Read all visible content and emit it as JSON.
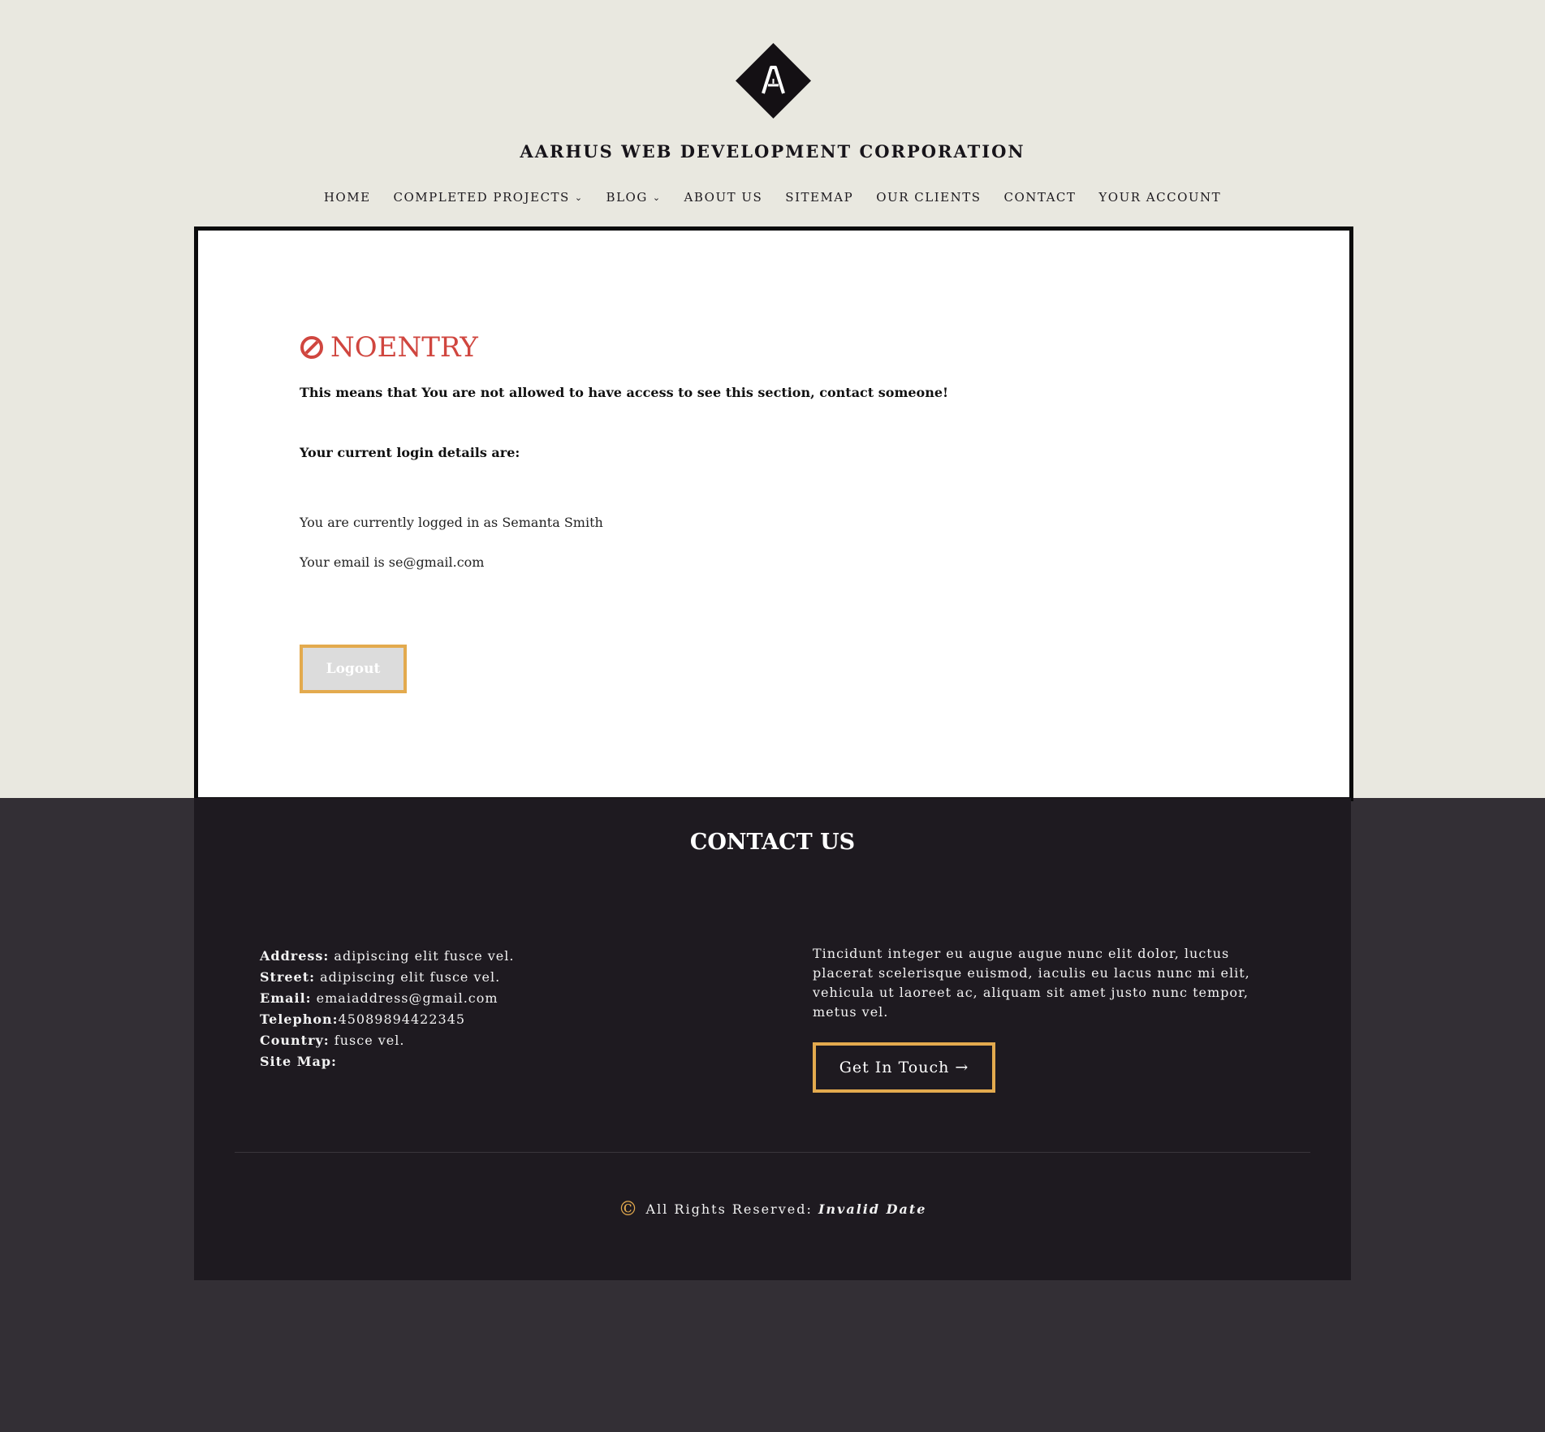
{
  "header": {
    "site_title": "AARHUS WEB DEVELOPMENT CORPORATION",
    "logo_letter": "A"
  },
  "nav": {
    "items": [
      {
        "label": "HOME",
        "has_dropdown": false
      },
      {
        "label": "COMPLETED PROJECTS",
        "has_dropdown": true
      },
      {
        "label": "BLOG",
        "has_dropdown": true
      },
      {
        "label": "ABOUT US",
        "has_dropdown": false
      },
      {
        "label": "SITEMAP",
        "has_dropdown": false
      },
      {
        "label": "OUR CLIENTS",
        "has_dropdown": false
      },
      {
        "label": "CONTACT",
        "has_dropdown": false
      },
      {
        "label": "YOUR ACCOUNT",
        "has_dropdown": false
      }
    ]
  },
  "main": {
    "heading": "NOENTRY",
    "message": "This means that You are not allowed to have access to see this section, contact someone!",
    "login_details_label": "Your current login details are:",
    "logged_in_text": "You are currently logged in as Semanta Smith",
    "email_text": "Your email is se@gmail.com",
    "logout_label": "Logout"
  },
  "footer": {
    "title": "CONTACT US",
    "address_label": "Address:",
    "address_value": " adipiscing elit fusce vel.",
    "street_label": "Street:",
    "street_value": " adipiscing elit fusce vel.",
    "email_label": "Email:",
    "email_value": " emaiaddress@gmail.com",
    "telephone_label": "Telephon:",
    "telephone_value": "45089894422345",
    "country_label": "Country:",
    "country_value": " fusce vel.",
    "sitemap_label": "Site Map:",
    "paragraph": "Tincidunt integer eu augue augue nunc elit dolor, luctus placerat scelerisque euismod, iaculis eu lacus nunc mi elit, vehicula ut laoreet ac, aliquam sit amet justo nunc tempor, metus vel.",
    "cta_label": "Get In Touch →",
    "copyright_symbol": "©",
    "rights_text": "All Rights Reserved: ",
    "date_text": "Invalid Date"
  },
  "colors": {
    "page_bg": "#e9e8e0",
    "footer_bg": "#1e1a20",
    "outer_bg": "#332f35",
    "accent": "#e3aa4e",
    "error_red": "#d0463f"
  }
}
